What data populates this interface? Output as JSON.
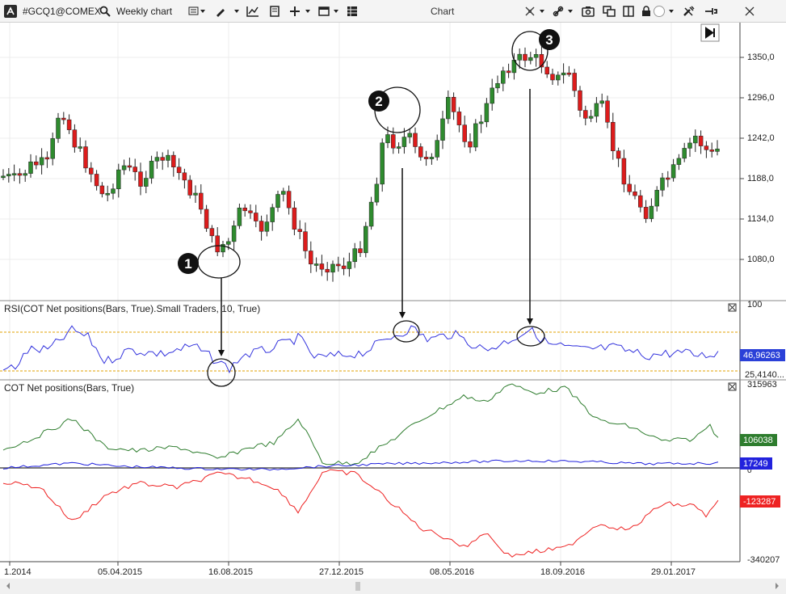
{
  "toolbar": {
    "symbol": "#GCQ1@COMEX",
    "timeframe": "Weekly chart",
    "title": "Chart"
  },
  "price_axis": {
    "labels": [
      "1350,0",
      "1296,0",
      "1242,0",
      "1188,0",
      "1134,0",
      "1080,0"
    ]
  },
  "rsi_panel": {
    "title": "RSI(COT Net positions(Bars, True).Small Traders, 10, True)",
    "top_label": "100",
    "value_badge": "46,96263",
    "low_label": "25,4140..."
  },
  "cot_panel": {
    "title": "COT Net positions(Bars, True)",
    "top_label": "315963",
    "bottom_label": "-340207",
    "zero_label": "0",
    "badge_green": "106038",
    "badge_blue": "17249",
    "badge_red": "-123287"
  },
  "time_axis": {
    "labels": [
      "1.2014",
      "05.04.2015",
      "16.08.2015",
      "27.12.2015",
      "08.05.2016",
      "18.09.2016",
      "29.01.2017"
    ]
  },
  "annotations": {
    "m1": "1",
    "m2": "2",
    "m3": "3"
  },
  "colors": {
    "up": "#2e8b2e",
    "down": "#dd1c1c",
    "rsi": "#3333dd",
    "green": "#2e7d2e",
    "blue": "#2222dd",
    "red": "#ee2222",
    "level": "#e0a000"
  }
}
